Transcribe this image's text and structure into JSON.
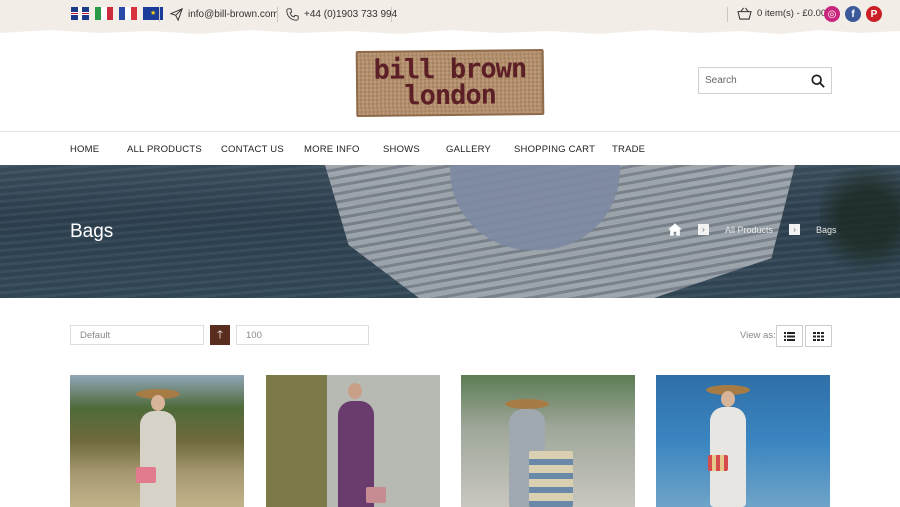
{
  "topbar": {
    "email": "info@bill-brown.com",
    "phone": "+44 (0)1903 733 994",
    "cart_text": "0 item(s) - £0.00",
    "flags": [
      "uk-flag-icon",
      "italy-flag-icon",
      "france-flag-icon",
      "eu-flag-icon"
    ],
    "social": [
      "instagram-icon",
      "facebook-icon",
      "pinterest-icon"
    ]
  },
  "logo": {
    "line1": "bill brown",
    "line2": "london"
  },
  "search": {
    "placeholder": "Search"
  },
  "nav": {
    "items": [
      "HOME",
      "ALL PRODUCTS",
      "CONTACT US",
      "MORE INFO",
      "SHOWS",
      "GALLERY",
      "SHOPPING CART",
      "TRADE"
    ]
  },
  "hero": {
    "title": "Bags",
    "breadcrumb": [
      "All Products",
      "Bags"
    ]
  },
  "controls": {
    "sort_value": "Default",
    "limit_value": "100",
    "view_as_label": "View as:"
  },
  "colors": {
    "topbar_bg": "#f3ede7",
    "accent_brown": "#5a2e1e",
    "logo_text": "#5c1f25"
  }
}
